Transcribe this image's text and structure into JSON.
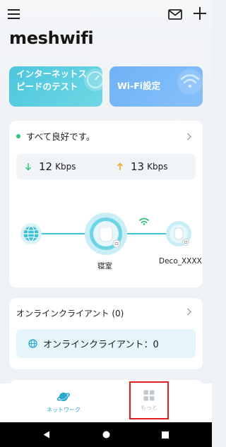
{
  "app": {
    "title": "meshwifi"
  },
  "header": {
    "menu_icon": "menu-icon",
    "mail_icon": "mail-icon",
    "add_icon": "plus-icon"
  },
  "tiles": [
    {
      "label": "インターネットスピードのテスト",
      "icon": "speedometer-icon",
      "color": "#4cc6dd"
    },
    {
      "label": "Wi-Fi設定",
      "icon": "wifi-icon",
      "color": "#6fb2f5"
    }
  ],
  "status_card": {
    "status_text": "すべて良好です。",
    "status_color": "#2bc27a",
    "download": {
      "value": "12",
      "unit": "Kbps",
      "arrow_color": "#2bc27a"
    },
    "upload": {
      "value": "13",
      "unit": "Kbps",
      "arrow_color": "#f2a51b"
    },
    "nodes": [
      {
        "label": "",
        "kind": "internet"
      },
      {
        "label": "寝室",
        "kind": "main-deco"
      },
      {
        "label": "Deco_XXXX",
        "kind": "satellite-deco"
      }
    ]
  },
  "clients_card": {
    "title": "オンラインクライアント (0)",
    "box_text": "オンラインクライアント：0"
  },
  "bottom_nav": [
    {
      "label": "ネットワーク",
      "icon": "planet-icon",
      "active": true
    },
    {
      "label": "もっと",
      "icon": "grid-icon",
      "active": false
    }
  ],
  "system_nav": {
    "back_icon": "back-icon",
    "home_icon": "home-icon",
    "recents_icon": "recents-icon"
  },
  "colors": {
    "accent": "#2aa8cf",
    "background": "#eef1f5",
    "highlight": "#e02020"
  }
}
